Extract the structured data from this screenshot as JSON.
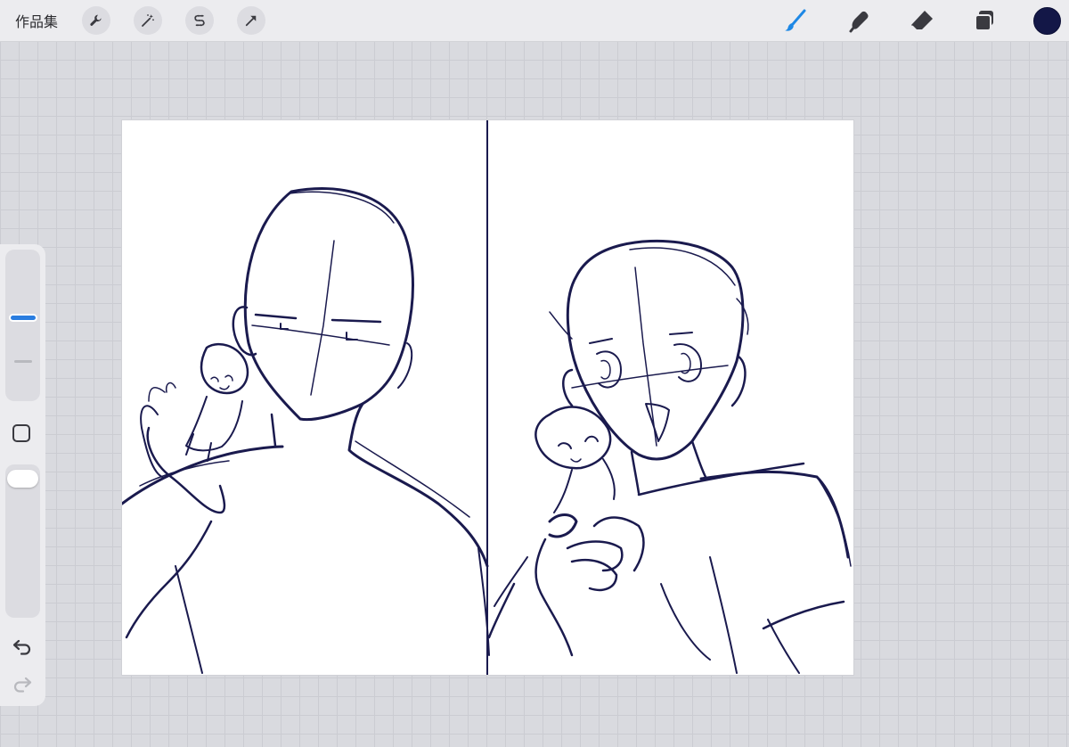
{
  "app": {
    "gallery_label": "作品集"
  },
  "toolbar": {
    "left_actions": [
      {
        "name": "actions",
        "icon": "wrench-icon"
      },
      {
        "name": "adjustments",
        "icon": "magic-wand-icon"
      },
      {
        "name": "selection",
        "icon": "selection-s-icon"
      },
      {
        "name": "transform",
        "icon": "arrow-cursor-icon"
      }
    ],
    "right_tools": [
      {
        "name": "brush",
        "icon": "brush-icon",
        "active": true
      },
      {
        "name": "smudge",
        "icon": "smudge-icon",
        "active": false
      },
      {
        "name": "eraser",
        "icon": "eraser-icon",
        "active": false
      },
      {
        "name": "layers",
        "icon": "layers-icon",
        "active": false
      }
    ],
    "active_tool_color": "#1e88e5",
    "current_color": "#131747"
  },
  "sidebar": {
    "brush_size_level": 0.55,
    "opacity_level": 1.0
  },
  "canvas": {
    "stroke_color": "#1a1a4e",
    "background": "#ffffff"
  }
}
